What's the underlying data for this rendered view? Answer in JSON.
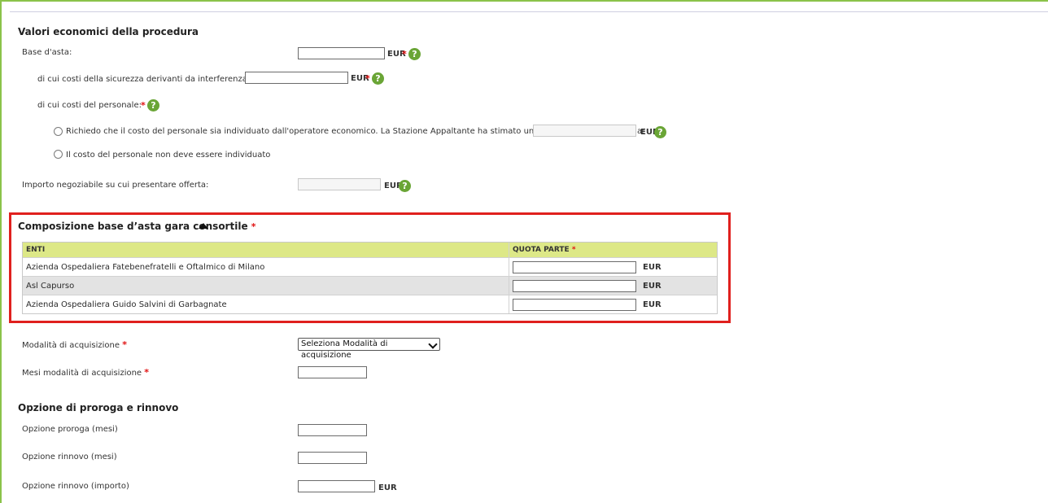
{
  "section_values": {
    "title": "Valori economici della procedura",
    "base_asta_label": "Base d'asta:",
    "sicurezza_label": "di cui costi della sicurezza derivanti da interferenza:",
    "personale_label": "di cui costi del personale:",
    "radio1_label": "Richiedo che il costo del personale sia individuato dall'operatore economico. La Stazione Appaltante ha stimato un costo del personale pari a:",
    "radio2_label": "Il costo del personale non deve essere individuato",
    "importo_label": "Importo negoziabile su cui presentare offerta:",
    "unit": "EUR",
    "required_mark": "*",
    "help_glyph": "?"
  },
  "consortile": {
    "title": "Composizione base d’asta gara consortile",
    "columns": {
      "enti": "ENTI",
      "quota": "QUOTA PARTE"
    },
    "rows": [
      {
        "ente": "Azienda Ospedaliera Fatebenefratelli e Oftalmico di Milano",
        "unit": "EUR"
      },
      {
        "ente": "Asl Capurso",
        "unit": "EUR"
      },
      {
        "ente": "Azienda Ospedaliera Guido Salvini di Garbagnate",
        "unit": "EUR"
      }
    ]
  },
  "acquisizione": {
    "modalita_label": "Modalità di acquisizione",
    "modalita_selected": "Seleziona Modalità di acquisizione",
    "mesi_label": "Mesi modalità di acquisizione"
  },
  "proroga": {
    "title": "Opzione di proroga e rinnovo",
    "proroga_mesi_label": "Opzione proroga (mesi)",
    "rinnovo_mesi_label": "Opzione rinnovo (mesi)",
    "rinnovo_importo_label": "Opzione rinnovo (importo)",
    "unit": "EUR"
  },
  "colors": {
    "accent_green": "#6aa536",
    "table_header": "#dde887",
    "highlight_red": "#e0201e",
    "required_red": "#e01010"
  }
}
